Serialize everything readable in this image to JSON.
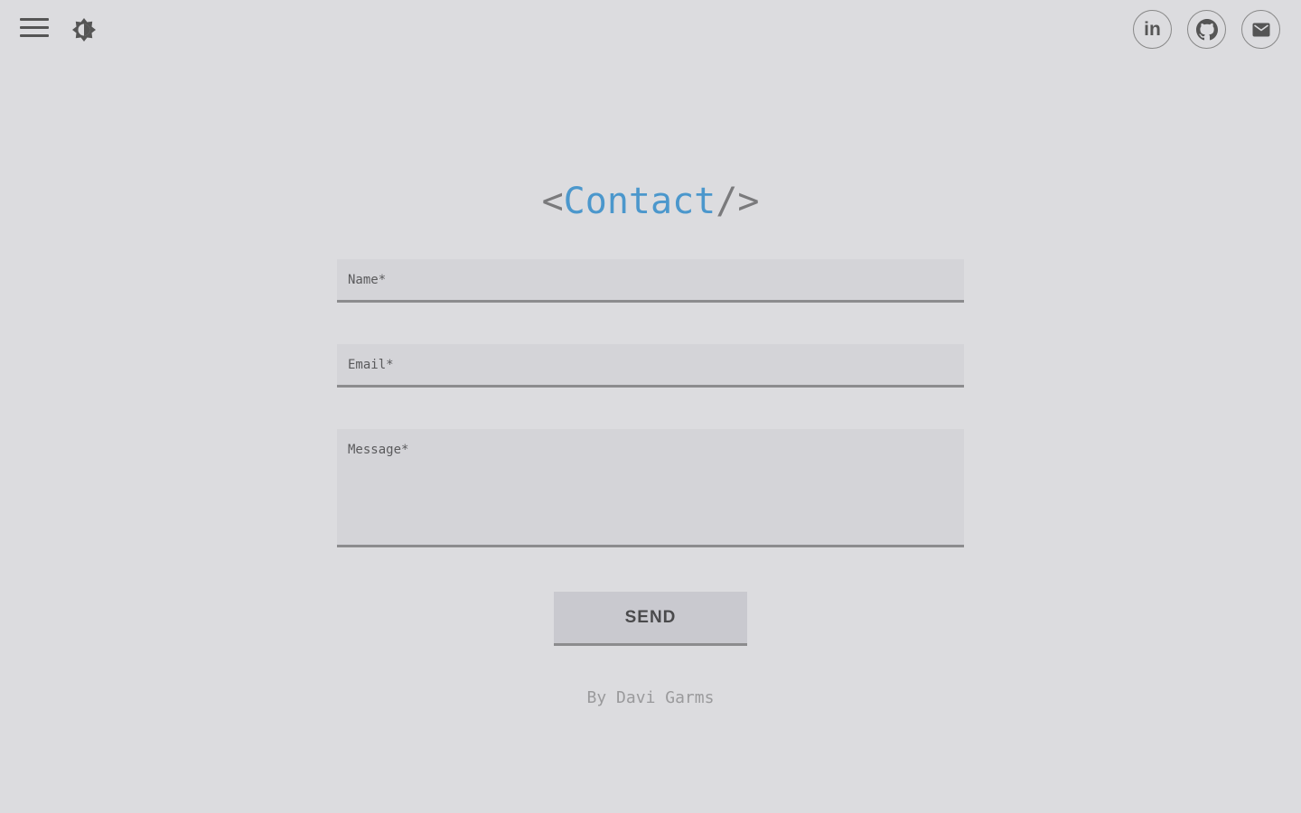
{
  "nav": {
    "menu_icon": "hamburger-menu-icon",
    "theme_icon": "brightness-contrast-icon"
  },
  "social": {
    "linkedin_text": "in",
    "github_icon": "github-icon",
    "mail_icon": "mail-icon"
  },
  "title": {
    "open_bracket": "<",
    "word": "Contact",
    "close_bracket": "/>"
  },
  "form": {
    "name_placeholder": "Name*",
    "email_placeholder": "Email*",
    "message_placeholder": "Message*",
    "send_label": "SEND"
  },
  "footer": {
    "text": "By Davi Garms"
  },
  "colors": {
    "background": "#dcdcdf",
    "accent": "#4b97cc",
    "field_bg": "#d4d4d8",
    "button_bg": "#c9c9cf"
  }
}
